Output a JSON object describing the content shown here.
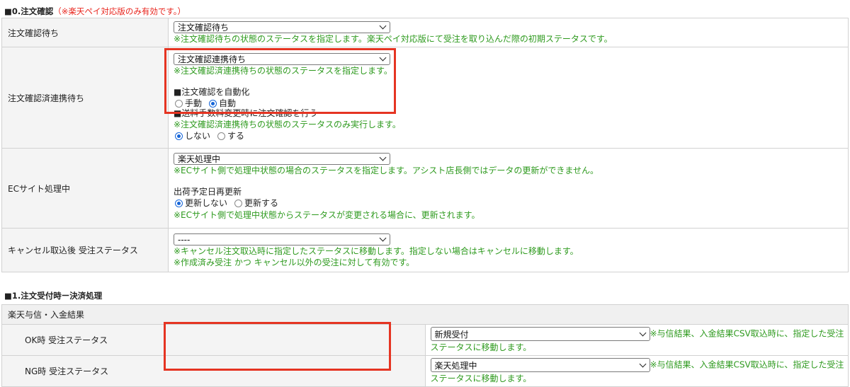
{
  "section0": {
    "title": "■0.注文確認",
    "note": "（※楽天ペイ対応版のみ有効です。）",
    "rows": [
      {
        "label": "注文確認待ち",
        "select": "注文確認待ち",
        "hint": "※注文確認待ちの状態のステータスを指定します。楽天ペイ対応版にて受注を取り込んだ際の初期ステータスです。"
      },
      {
        "label": "注文確認済連携待ち",
        "select": "注文確認連携待ち",
        "hint": "※注文確認済連携待ちの状態のステータスを指定します。",
        "auto_heading": "■注文確認を自動化",
        "auto_options": [
          "手動",
          "自動"
        ],
        "shipping_heading": "■送料手数料変更時に注文確認を行う",
        "shipping_hint": "※注文確認済連携待ちの状態のステータスのみ実行します。",
        "shipping_options": [
          "しない",
          "する"
        ]
      },
      {
        "label": "ECサイト処理中",
        "select": "楽天処理中",
        "hint": "※ECサイト側で処理中状態の場合のステータスを指定します。アシスト店長側ではデータの更新ができません。",
        "reship_heading": "出荷予定日再更新",
        "reship_options": [
          "更新しない",
          "更新する"
        ],
        "reship_hint": "※ECサイト側で処理中状態からステータスが変更される場合に、更新されます。"
      },
      {
        "label": "キャンセル取込後 受注ステータス",
        "select": "----",
        "hint1": "※キャンセル注文取込時に指定したステータスに移動します。指定しない場合はキャンセルに移動します。",
        "hint2": "※作成済み受注 かつ キャンセル以外の受注に対して有効です。"
      }
    ]
  },
  "section1": {
    "title": "■1.注文受付時ー決済処理",
    "group_label": "楽天与信・入金結果",
    "rows": [
      {
        "label": "OK時 受注ステータス",
        "select": "新規受付",
        "hint": "※与信結果、入金結果CSV取込時に、指定した受注ステータスに移動します。"
      },
      {
        "label": "NG時 受注ステータス",
        "select": "楽天処理中",
        "hint": "※与信結果、入金結果CSV取込時に、指定した受注ステータスに移動します。"
      }
    ]
  },
  "colors": {
    "hint": "#2e9a1e",
    "note": "#e8231b",
    "highlight": "#e53422",
    "radio_on": "#1565d8"
  },
  "icons": [
    "chevron-down-icon",
    "radio-checked-icon",
    "radio-unchecked-icon"
  ]
}
